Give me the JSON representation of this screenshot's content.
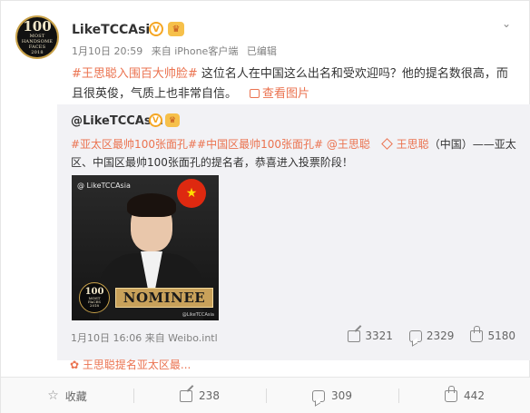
{
  "post": {
    "avatar": {
      "big": "100",
      "lines": [
        "MOST",
        "HANDSOME",
        "FACES",
        "2018"
      ]
    },
    "nickname": "LikeTCCAsia",
    "verified_mark": "V",
    "crown_icon": "crown-icon",
    "date": "1月10日 20:59",
    "source": "来自 iPhone客户端",
    "edited": "已编辑",
    "text": {
      "topic": "#王思聪入围百大帅脸#",
      "body": " 这位名人在中国这么出名和受欢迎吗？他的提名数很高，而且很英俊，气质上也非常自信。",
      "see_pic": "查看图片"
    }
  },
  "repost": {
    "nickname": "@LikeTCCAsia",
    "verified_mark": "V",
    "text": {
      "topic1": "#亚太区最帅100张面孔##中国区最帅100张面孔#",
      "mention": " @王思聪 ",
      "mention2": "王思聪",
      "plain1": "（中国）——亚太区、中国区最帅100张面孔的提名者，恭喜进入投票阶段！"
    },
    "photo": {
      "watermark": "@ LikeTCCAsia",
      "flag_star": "★",
      "logo_big": "100",
      "logo_lines": [
        "MOST",
        "FACES",
        "2018"
      ],
      "nominee": "NOMINEE",
      "credit": "@LikeTCCAsia"
    },
    "meta": "1月10日 16:06 来自 Weibo.intl",
    "stats": {
      "share": "3321",
      "comment": "2329",
      "like": "5180"
    }
  },
  "related": {
    "icon": "flower-icon",
    "text": "王思聪提名亚太区最..."
  },
  "actions": {
    "favorite": "收藏",
    "share": "238",
    "comment": "309",
    "like": "442"
  },
  "colors": {
    "accent": "#eb7350",
    "gold": "#c8a15a",
    "verified": "#f5a623"
  }
}
